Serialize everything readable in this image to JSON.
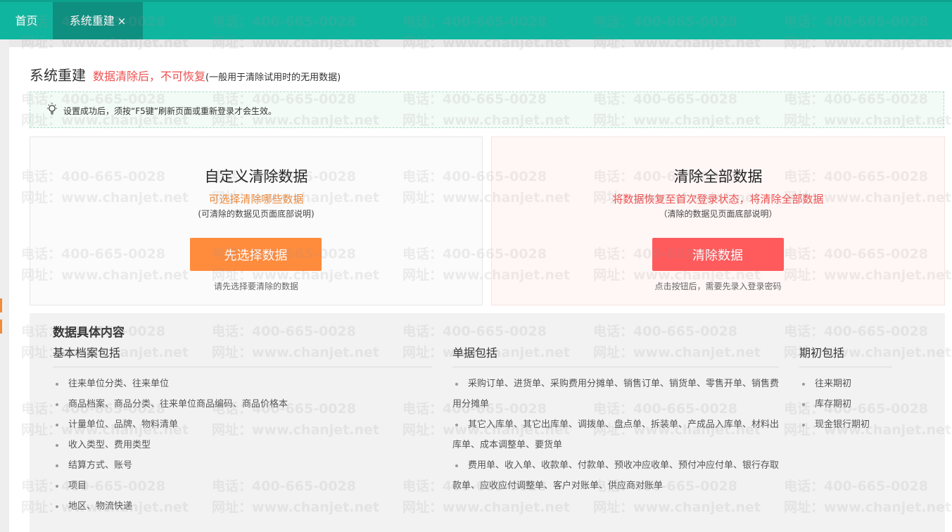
{
  "tabs": [
    {
      "label": "首页"
    },
    {
      "label": "系统重建",
      "close": "×"
    }
  ],
  "header": {
    "title": "系统重建",
    "warning": "数据清除后，不可恢复",
    "note": "(一般用于清除试用时的无用数据)"
  },
  "notice": {
    "text": "设置成功后，须按“F5键”刷新页面或重新登录才会生效。"
  },
  "custom_clear": {
    "title": "自定义清除数据",
    "subtitle": "可选择清除哪些数据",
    "paren": "(可清除的数据见页面底部说明)",
    "button": "先选择数据",
    "hint": "请先选择要清除的数据"
  },
  "clear_all": {
    "title": "清除全部数据",
    "subtitle": "将数据恢复至首次登录状态，将清除全部数据",
    "paren": "（清除的数据见页面底部说明）",
    "button": "清除数据",
    "hint": "点击按钮后，需要先录入登录密码"
  },
  "details": {
    "title": "数据具体内容",
    "basic": {
      "title": "基本档案包括",
      "items": [
        "往来单位分类、往来单位",
        "商品档案、商品分类、往来单位商品编码、商品价格本",
        "计量单位、品牌、物料清单",
        "收入类型、费用类型",
        "结算方式、账号",
        "项目",
        "地区、物流快递"
      ]
    },
    "documents": {
      "title": "单据包括",
      "items": [
        "采购订单、进货单、采购费用分摊单、销售订单、销货单、零售开单、销售费用分摊单",
        "其它入库单、其它出库单、调拨单、盘点单、拆装单、产成品入库单、材料出库单、成本调整单、要货单",
        "费用单、收入单、收款单、付款单、预收冲应收单、预付冲应付单、银行存取款单、应收应付调整单、客户对账单、供应商对账单"
      ]
    },
    "opening": {
      "title": "期初包括",
      "items": [
        "往来期初",
        "库存期初",
        "现金银行期初"
      ]
    }
  },
  "watermark": {
    "phone": "电话：400-665-0028",
    "site": "网址：www.chanjet.net"
  },
  "colors": {
    "tabbar": "#10b59f",
    "active_tab": "#0f8f80",
    "orange": "#ff8b3d",
    "red": "#ff5a5c",
    "warn_text": "#ef4d4d"
  }
}
